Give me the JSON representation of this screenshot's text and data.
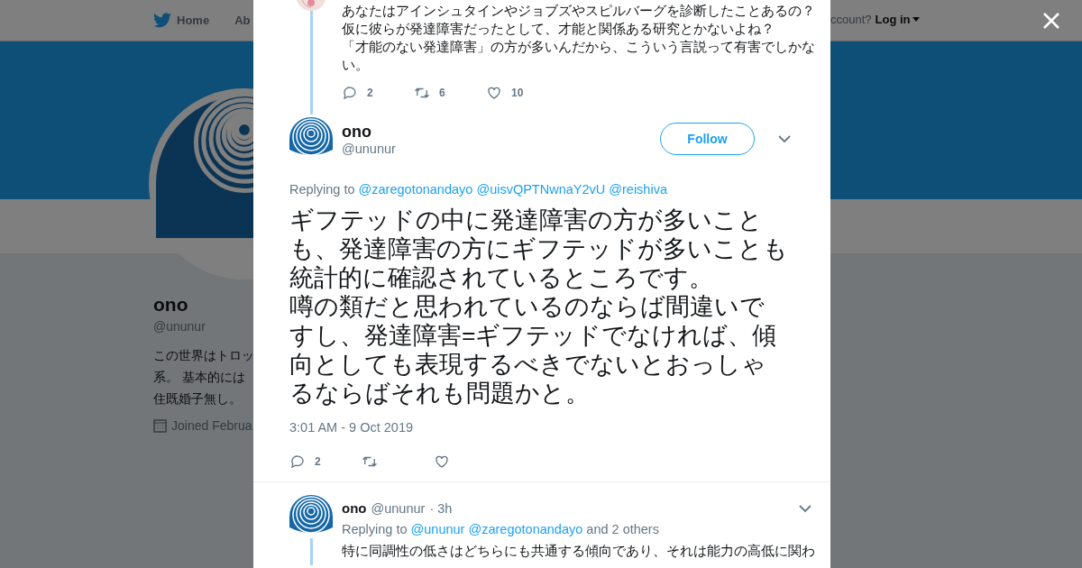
{
  "nav": {
    "items": [
      {
        "label": "Home"
      },
      {
        "label": "Ab"
      }
    ],
    "account_prompt": "ccount?",
    "login": "Log in"
  },
  "profile": {
    "name": "ono",
    "handle": "@ununur",
    "bio_lines": [
      "この世界はトロッ",
      "系。 基本的には",
      "住既婚子無し。"
    ],
    "joined": "Joined Februa"
  },
  "modal": {
    "parent_tweet": {
      "lines": [
        "あなたはアインシュタインやジョブズやスピルバーグを診断したことあるの？",
        "仮に彼らが発達障害だったとして、才能と関係ある研究とかないよね？",
        "「才能のない発達障害」の方が多いんだから、こういう言説って有害でしかな",
        "い。"
      ],
      "replies": "2",
      "retweets": "6",
      "likes": "10"
    },
    "main_tweet": {
      "name": "ono",
      "handle": "@ununur",
      "follow": "Follow",
      "replying_label": "Replying to",
      "replying_to": [
        "@zaregotonandayo",
        "@uisvQPTNwnaY2vU",
        "@reishiva"
      ],
      "lines": [
        "ギフテッドの中に発達障害の方が多いこと",
        "も、発達障害の方にギフテッドが多いことも",
        "統計的に確認されているところです。",
        "噂の類だと思われているのならば間違いで",
        "すし、発達障害=ギフテッドでなければ、傾",
        "向としても表現するべきでないとおっしゃ",
        "るならばそれも問題かと。"
      ],
      "timestamp": "3:01 AM - 9 Oct 2019",
      "replies": "2"
    },
    "reply_tweet": {
      "name": "ono",
      "handle": "@ununur",
      "time": "· 3h",
      "replying_label": "Replying to",
      "replying_to": [
        "@ununur",
        "@zaregotonandayo"
      ],
      "others": "and 2 others",
      "lines": [
        "特に同調性の低さはどちらにも共通する傾向であり、それは能力の高低に関わ"
      ]
    }
  }
}
